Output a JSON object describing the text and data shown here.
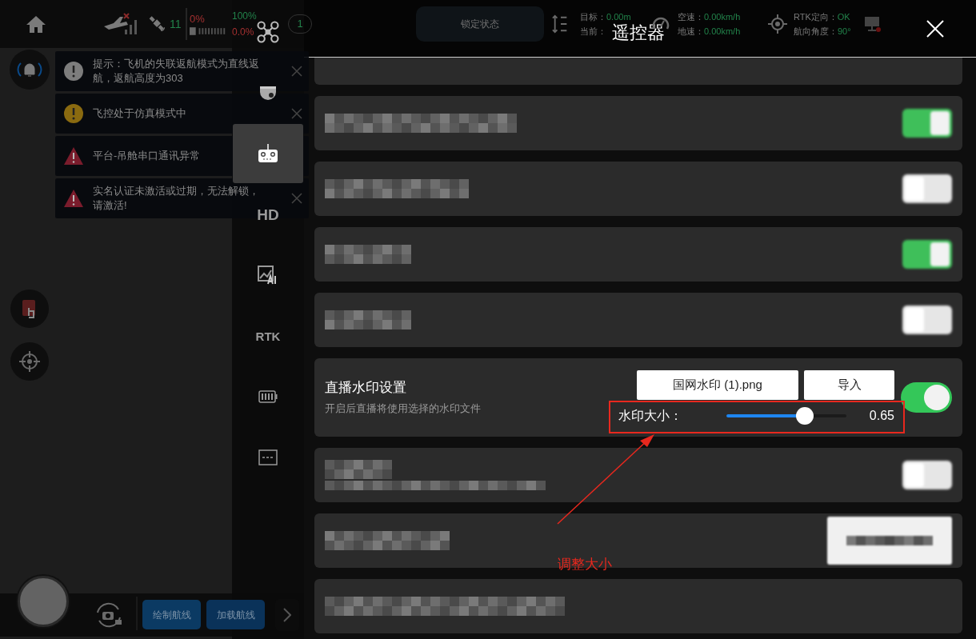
{
  "top_bar": {
    "satellites": "11",
    "battery_percent": "0%",
    "storage_percent": "100%",
    "storage_used": "0.0%",
    "count": "1",
    "lock_state": "锁定状态",
    "target_altitude": {
      "label": "目标：",
      "value": "0.00m"
    },
    "current_altitude_label": "当前：",
    "air_speed": {
      "label": "空速：",
      "value": "0.00km/h"
    },
    "ground_speed": {
      "label": "地速：",
      "value": "0.00km/h"
    },
    "rtk_heading": {
      "label": "RTK定向：",
      "value": "OK"
    },
    "heading_angle": {
      "label": "航向角度：",
      "value": "90°"
    }
  },
  "notifications": [
    {
      "kind": "info",
      "text": "提示：飞机的失联返航模式为直线返航，返航高度为303"
    },
    {
      "kind": "warning",
      "text": "飞控处于仿真模式中"
    },
    {
      "kind": "error",
      "text": "平台-吊舱串口通讯异常"
    },
    {
      "kind": "error",
      "text": "实名认证未激活或过期，无法解锁，请激活!"
    }
  ],
  "bottom_bar": {
    "draw_route": "绘制航线",
    "load_route": "加载航线"
  },
  "panel": {
    "title": "遥控器",
    "tabs": [
      {
        "kind": "drone",
        "selected": false
      },
      {
        "kind": "gimbal",
        "selected": false
      },
      {
        "kind": "remote",
        "selected": true
      },
      {
        "kind": "text",
        "label": "HD",
        "selected": false
      },
      {
        "kind": "ai_image",
        "selected": false
      },
      {
        "kind": "text",
        "label": "RTK",
        "selected": false
      },
      {
        "kind": "battery",
        "selected": false
      },
      {
        "kind": "more",
        "selected": false
      }
    ],
    "rows": [
      {
        "kind": "partial"
      },
      {
        "kind": "redacted",
        "on": true
      },
      {
        "kind": "redacted",
        "on": false
      },
      {
        "kind": "redacted",
        "on": true
      },
      {
        "kind": "redacted",
        "on": false
      },
      {
        "kind": "watermark",
        "title": "直播水印设置",
        "subtitle": "开启后直播将使用选择的水印文件",
        "file": "国网水印 (1).png",
        "import": "导入",
        "size_label": "水印大小：",
        "level": 0.65,
        "reading": "0.65",
        "on": true
      },
      {
        "kind": "redacted_two_line",
        "on": false
      },
      {
        "kind": "redacted_button"
      },
      {
        "kind": "redacted_partial"
      }
    ]
  },
  "annotation": {
    "label": "调整大小"
  }
}
